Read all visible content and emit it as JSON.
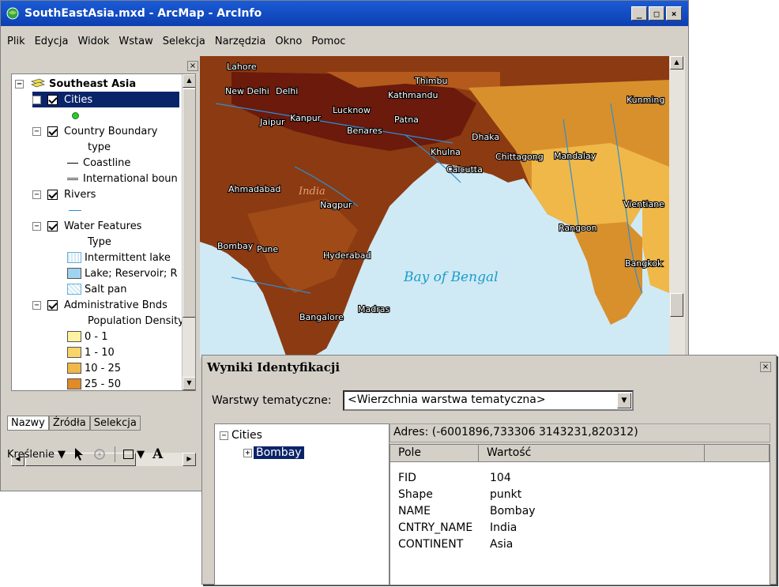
{
  "window": {
    "title": "SouthEastAsia.mxd - ArcMap - ArcInfo",
    "min": "_",
    "max": "□",
    "close": "×"
  },
  "menu": [
    "Plik",
    "Edycja",
    "Widok",
    "Wstaw",
    "Selekcja",
    "Narzędzia",
    "Okno",
    "Pomoc"
  ],
  "toc": {
    "close": "×",
    "root": "Southeast Asia",
    "items": [
      {
        "label": "Cities"
      },
      {
        "label": "Country Boundary"
      },
      {
        "label": "type"
      },
      {
        "label": "Coastline"
      },
      {
        "label": "International boun"
      },
      {
        "label": "Rivers"
      },
      {
        "label": "Water Features"
      },
      {
        "label": "Type"
      },
      {
        "label": "Intermittent lake"
      },
      {
        "label": "Lake; Reservoir; R"
      },
      {
        "label": "Salt pan"
      },
      {
        "label": "Administrative Bnds"
      },
      {
        "label": "Population Density"
      },
      {
        "label": "0 - 1"
      },
      {
        "label": "1 - 10"
      },
      {
        "label": "10 - 25"
      },
      {
        "label": "25 - 50"
      }
    ],
    "tabs": [
      "Nazwy",
      "Źródła",
      "Selekcja"
    ]
  },
  "draw": {
    "label": "Kreślenie",
    "text_tool": "A"
  },
  "map": {
    "cities": [
      "Lahore",
      "New Delhi",
      "Delhi",
      "Thimbu",
      "Kathmandu",
      "Kunming",
      "Jaipur",
      "Kanpur",
      "Lucknow",
      "Patna",
      "Benares",
      "Dhaka",
      "Khulna",
      "Chittagong",
      "Mandalay",
      "Calcutta",
      "Ahmadabad",
      "Nagpur",
      "Vientiane",
      "Rangoon",
      "Bombay",
      "Pune",
      "Hyderabad",
      "Bangkok",
      "Madras",
      "Bangalore"
    ],
    "country": "India",
    "bay": "Bay of Bengal"
  },
  "identify": {
    "title": "Wyniki Identyfikacji",
    "close": "×",
    "layers_label": "Warstwy tematyczne:",
    "layers_value": "<Wierzchnia warstwa tematyczna>",
    "tree_root": "Cities",
    "tree_child": "Bombay",
    "address": "Adres: (-6001896,733306 3143231,820312)",
    "col_field": "Pole",
    "col_value": "Wartość",
    "rows": [
      {
        "k": "FID",
        "v": "104"
      },
      {
        "k": "Shape",
        "v": "punkt"
      },
      {
        "k": "NAME",
        "v": "Bombay"
      },
      {
        "k": "CNTRY_NAME",
        "v": "India"
      },
      {
        "k": "CONTINENT",
        "v": "Asia"
      }
    ]
  },
  "colors": {
    "title_blue": "#0d3fb0",
    "selection": "#0a246a",
    "water": "#cfeaf5",
    "d1": "#6b1a0c",
    "d2": "#8c3a12",
    "d3": "#b45a1c",
    "d4": "#d8902c",
    "d5": "#f0b848"
  }
}
